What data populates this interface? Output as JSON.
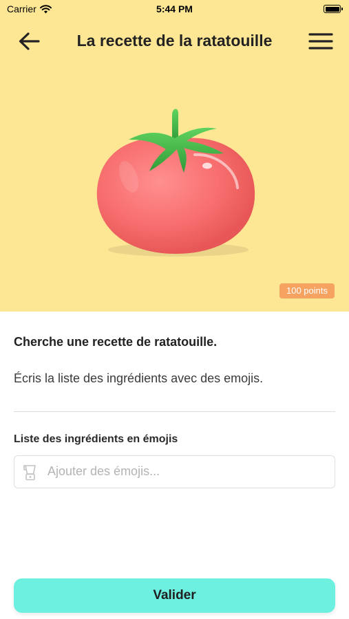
{
  "status_bar": {
    "carrier": "Carrier",
    "time": "5:44 PM",
    "battery_level": 1.0
  },
  "nav": {
    "title": "La recette de la ratatouille",
    "back_icon": "arrow-left-icon",
    "menu_icon": "hamburger-menu-icon"
  },
  "hero": {
    "background": "#fde795",
    "illustration": "tomato",
    "points_badge": "100 points",
    "badge_color": "#f6a361"
  },
  "task": {
    "heading": "Cherche une recette de ratatouille.",
    "instruction": "Écris la liste des ingrédients avec des emojis."
  },
  "form": {
    "label": "Liste des ingrédients en émojis",
    "placeholder": "Ajouter des émojis...",
    "value": "",
    "field_icon": "blender-icon"
  },
  "actions": {
    "submit_label": "Valider",
    "submit_color": "#6df0e0"
  }
}
